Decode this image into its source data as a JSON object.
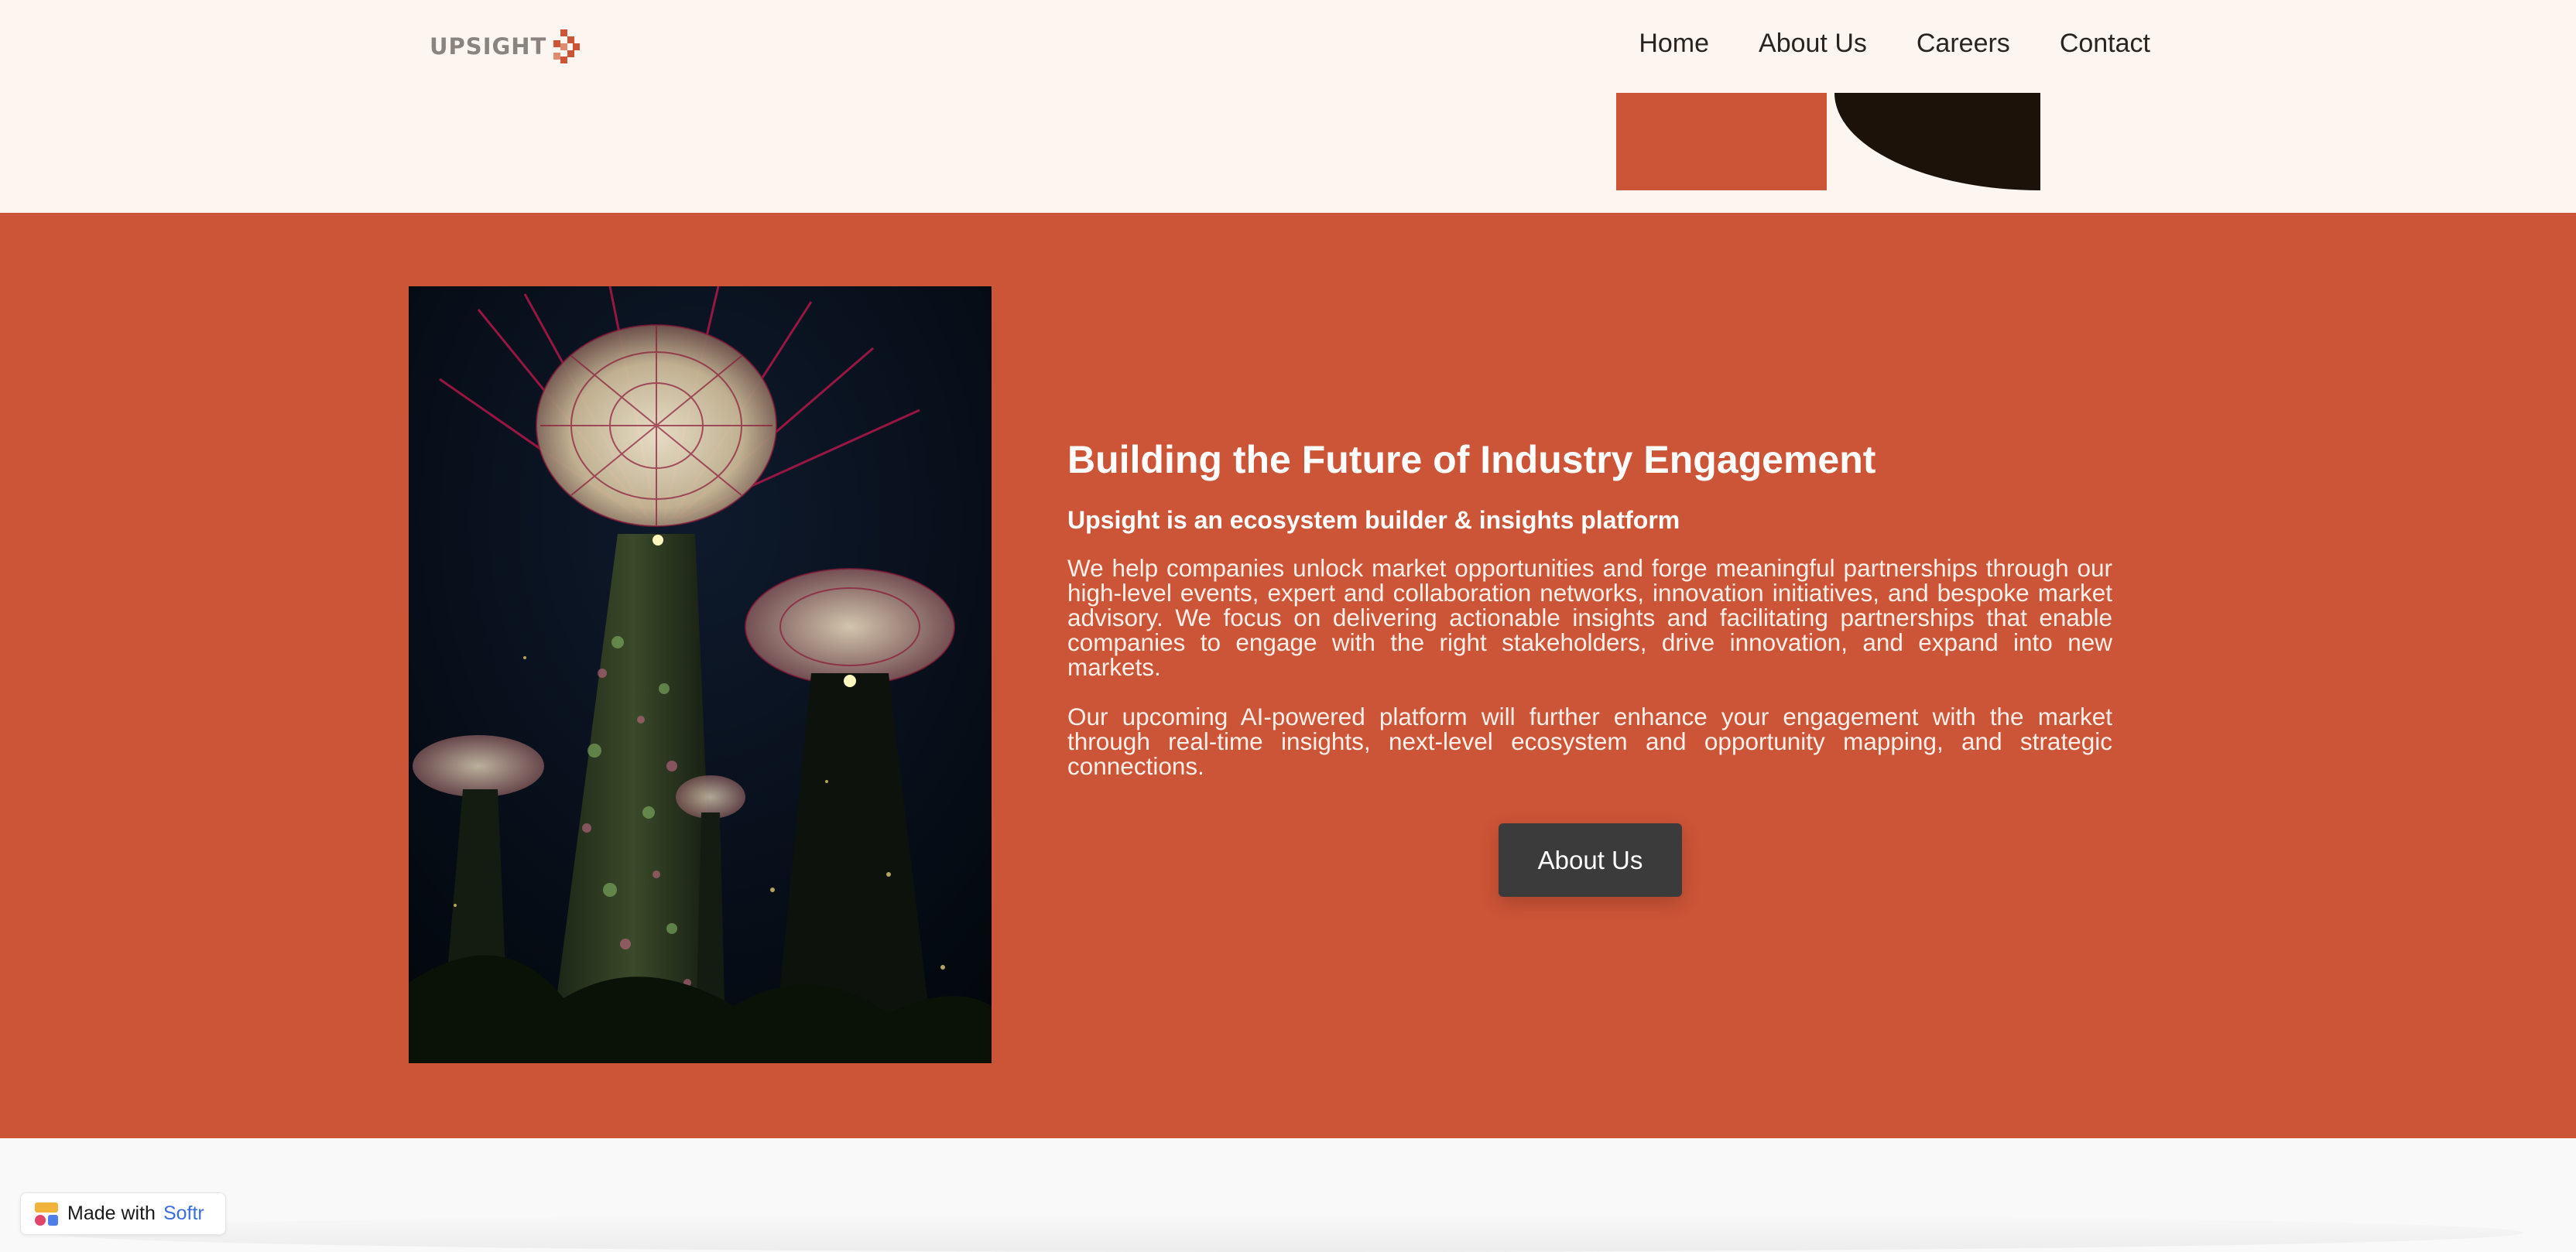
{
  "header": {
    "logo_text": "UPSIGHT",
    "nav": [
      {
        "label": "Home"
      },
      {
        "label": "About Us"
      },
      {
        "label": "Careers"
      },
      {
        "label": "Contact"
      }
    ]
  },
  "hero": {
    "title": "Building the Future of Industry Engagement",
    "subtitle": "Upsight is an ecosystem builder & insights platform",
    "paragraph_1": "We help companies unlock market opportunities and forge meaningful partnerships through our high-level events, expert and collaboration networks, innovation initiatives, and bespoke market advisory. We focus on delivering actionable insights and facilitating partnerships that enable companies to engage with the right stakeholders, drive innovation, and expand into new markets.",
    "paragraph_2": "Our upcoming AI-powered platform will further enhance your engagement with the market through real-time insights, next-level ecosystem and opportunity mapping, and strategic connections.",
    "button_label": "About Us"
  },
  "badge": {
    "made_with": "Made with",
    "brand": "Softr"
  },
  "colors": {
    "accent": "#cc5437",
    "header_bg": "#fdf5f0",
    "dark_shape": "#1c120a",
    "button": "#3b3b3b",
    "brand_link": "#3b6fe0"
  },
  "icons": {
    "logo_mark": "pixel-arrow-logo-icon",
    "badge_icon": "softr-logo-icon"
  }
}
